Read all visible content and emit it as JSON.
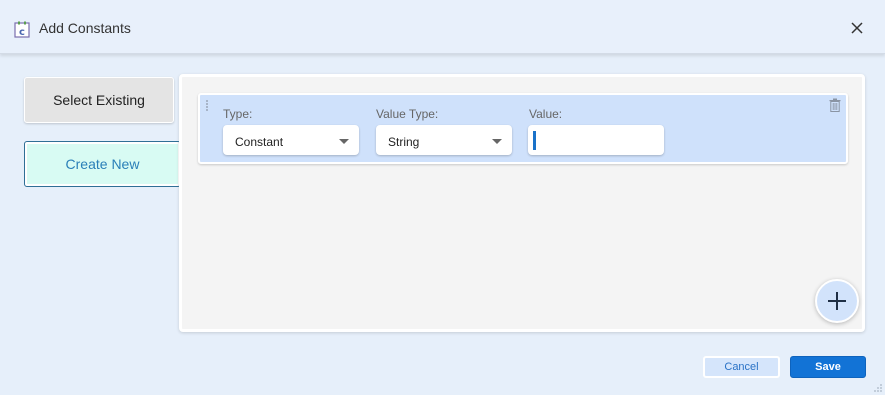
{
  "dialog": {
    "title": "Add Constants",
    "icon": "constants-icon",
    "close_icon": "close-icon"
  },
  "sidebar": {
    "select_existing_label": "Select Existing",
    "create_new_label": "Create New",
    "active": "create_new"
  },
  "row": {
    "type_label": "Type:",
    "type_value": "Constant",
    "value_type_label": "Value Type:",
    "value_type_value": "String",
    "value_label": "Value:",
    "value": "",
    "drag_icon": "drag-handle-icon",
    "delete_icon": "trash-icon"
  },
  "add_button_icon": "plus-icon",
  "footer": {
    "cancel_label": "Cancel",
    "save_label": "Save"
  },
  "colors": {
    "accent": "#1273d6",
    "row_background": "#cfe1fb",
    "create_new_background": "#d8fbf3"
  }
}
